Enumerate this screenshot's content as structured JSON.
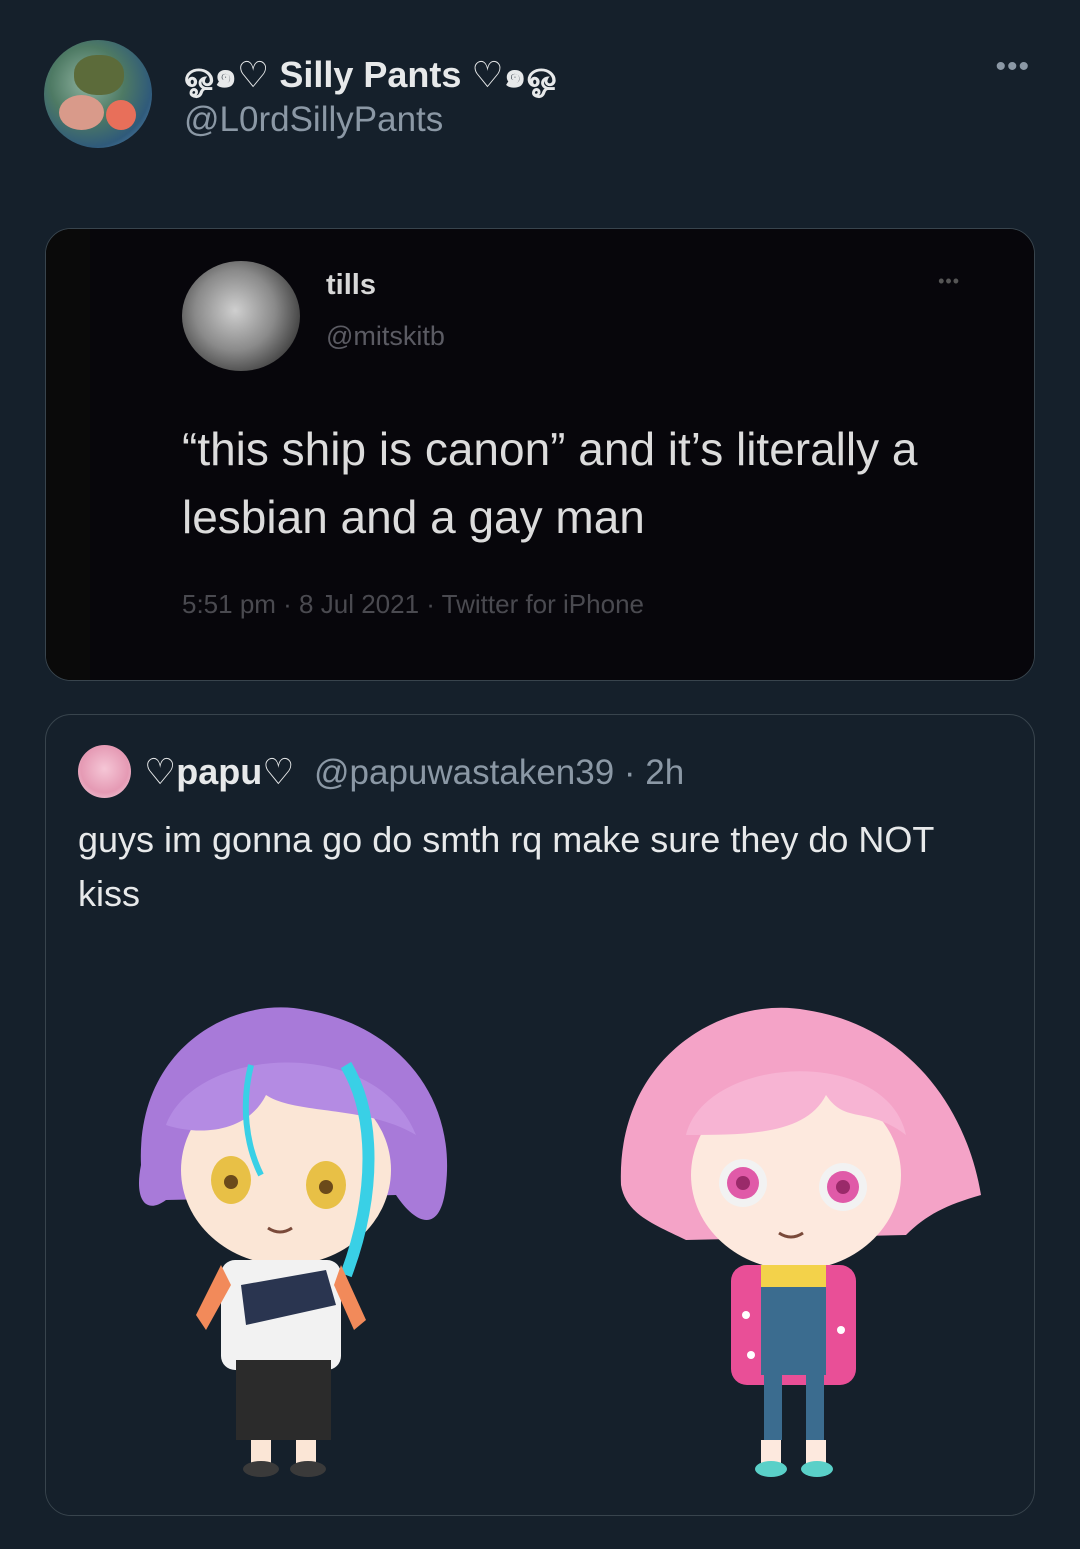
{
  "tweet": {
    "display_name": "ஓ๑♡ Silly Pants ♡๑ஓ",
    "handle": "@L0rdSillyPants",
    "more_label": "•••"
  },
  "screenshot": {
    "name": "tills",
    "handle": "@mitskitb",
    "more_label": "•••",
    "text": "“this ship is canon” and it’s literally a lesbian and a gay man",
    "meta": "5:51 pm · 8 Jul 2021 · Twitter for iPhone"
  },
  "quote": {
    "display_name": "♡papu♡",
    "handle_time": "@papuwastaken39 · 2h",
    "text": "guys im gonna go do smth rq make sure they do NOT kiss"
  },
  "colors": {
    "background": "#15202b",
    "border": "#38444d",
    "secondary_text": "#8b98a5"
  }
}
